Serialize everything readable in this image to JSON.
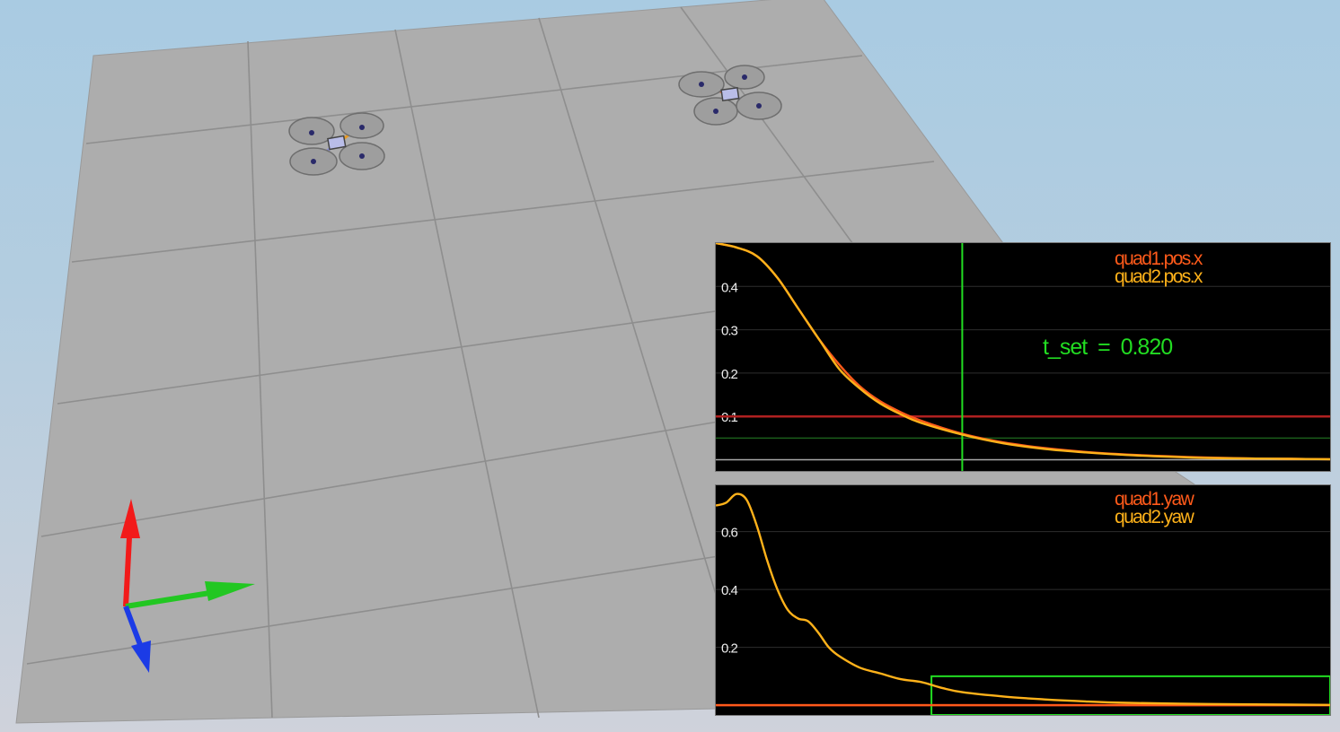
{
  "scene": {
    "ground_color": "#adadad",
    "grid_color": "#8e8e8e",
    "axes_gizmo": {
      "x_color": "#22c722",
      "y_color": "#1b3be6",
      "z_color": "#f21a1a"
    },
    "quads": [
      {
        "name": "quad1",
        "arm_colors": [
          "#e89922",
          "#8a8fd0"
        ]
      },
      {
        "name": "quad2",
        "arm_colors": [
          "#e25a2a",
          "#8a8fd0"
        ]
      }
    ]
  },
  "plot_top": {
    "legend": [
      "quad1.pos.x",
      "quad2.pos.x"
    ],
    "annotation": "t_set  =  0.820"
  },
  "plot_bottom": {
    "legend": [
      "quad1.yaw",
      "quad2.yaw"
    ]
  },
  "chart_data": [
    {
      "type": "line",
      "title": "",
      "y_ticks": [
        "0.4",
        "0.3",
        "0.2",
        "0.1"
      ],
      "ylim": [
        -0.03,
        0.5
      ],
      "xlim": [
        0,
        3.0
      ],
      "grid": true,
      "legend_position": "top-right",
      "threshold_line": {
        "y": 0.1,
        "color": "#b02020"
      },
      "settle_band": {
        "y": 0.05,
        "color": "#1a5e1a"
      },
      "vertical_marker": {
        "x": 1.2,
        "color": "#22dd22"
      },
      "series": [
        {
          "name": "quad1.pos.x",
          "color": "#ff5a1a",
          "x": [
            0,
            0.1,
            0.2,
            0.3,
            0.4,
            0.5,
            0.6,
            0.7,
            0.8,
            0.9,
            1.0,
            1.2,
            1.4,
            1.6,
            1.8,
            2.0,
            2.2,
            2.4,
            2.6,
            2.8,
            3.0
          ],
          "y": [
            0.5,
            0.49,
            0.47,
            0.42,
            0.35,
            0.28,
            0.22,
            0.17,
            0.135,
            0.11,
            0.09,
            0.06,
            0.04,
            0.027,
            0.018,
            0.012,
            0.008,
            0.005,
            0.003,
            0.002,
            0.001
          ]
        },
        {
          "name": "quad2.pos.x",
          "color": "#ffb21a",
          "x": [
            0,
            0.1,
            0.2,
            0.3,
            0.4,
            0.5,
            0.6,
            0.7,
            0.8,
            0.9,
            1.0,
            1.2,
            1.4,
            1.6,
            1.8,
            2.0,
            2.2,
            2.4,
            2.6,
            2.8,
            3.0
          ],
          "y": [
            0.5,
            0.49,
            0.47,
            0.42,
            0.35,
            0.28,
            0.21,
            0.165,
            0.13,
            0.105,
            0.085,
            0.058,
            0.038,
            0.025,
            0.017,
            0.011,
            0.007,
            0.004,
            0.003,
            0.002,
            0.001
          ]
        }
      ]
    },
    {
      "type": "line",
      "title": "",
      "y_ticks": [
        "0.6",
        "0.4",
        "0.2"
      ],
      "ylim": [
        -0.04,
        0.76
      ],
      "xlim": [
        0,
        3.0
      ],
      "grid": true,
      "legend_position": "top-right",
      "threshold_line": {
        "y": 0.0,
        "color": "#b02020"
      },
      "settle_box": {
        "x_start": 1.05,
        "y_top": 0.1,
        "color": "#22dd22"
      },
      "series": [
        {
          "name": "quad1.yaw",
          "color": "#ff5a1a",
          "x": [
            0,
            3.0
          ],
          "y": [
            0.0,
            0.0
          ]
        },
        {
          "name": "quad2.yaw",
          "color": "#ffb21a",
          "x": [
            0,
            0.05,
            0.1,
            0.15,
            0.2,
            0.25,
            0.3,
            0.35,
            0.4,
            0.45,
            0.5,
            0.55,
            0.6,
            0.7,
            0.8,
            0.9,
            1.0,
            1.1,
            1.2,
            1.4,
            1.6,
            1.8,
            2.0,
            2.4,
            2.8,
            3.0
          ],
          "y": [
            0.69,
            0.7,
            0.73,
            0.71,
            0.62,
            0.5,
            0.4,
            0.33,
            0.3,
            0.29,
            0.25,
            0.2,
            0.17,
            0.13,
            0.11,
            0.09,
            0.08,
            0.06,
            0.045,
            0.03,
            0.02,
            0.013,
            0.008,
            0.004,
            0.002,
            0.001
          ]
        }
      ]
    }
  ]
}
